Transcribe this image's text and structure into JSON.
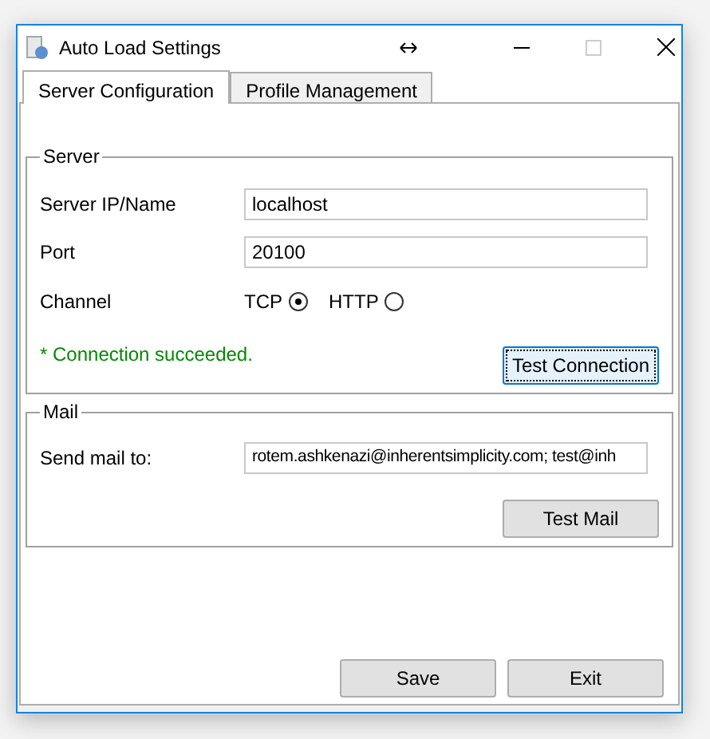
{
  "window": {
    "title": "Auto Load Settings"
  },
  "tabs": [
    {
      "label": "Server Configuration",
      "selected": true
    },
    {
      "label": "Profile Management",
      "selected": false
    }
  ],
  "server": {
    "title": "Server",
    "fields": [
      {
        "label": "Server IP/Name",
        "value": "localhost"
      },
      {
        "label": "Port",
        "value": "20100"
      }
    ],
    "channel": {
      "label": "Channel",
      "options": [
        {
          "label": "TCP",
          "selected": true
        },
        {
          "label": "HTTP",
          "selected": false
        }
      ]
    },
    "status": "* Connection succeeded.",
    "button": "Test Connection"
  },
  "mail": {
    "title": "Mail",
    "label": "Send mail to:",
    "value": "rotem.ashkenazi@inherentsimplicity.com; test@inh",
    "button": "Test Mail"
  },
  "buttons": [
    "Save",
    "Exit"
  ]
}
